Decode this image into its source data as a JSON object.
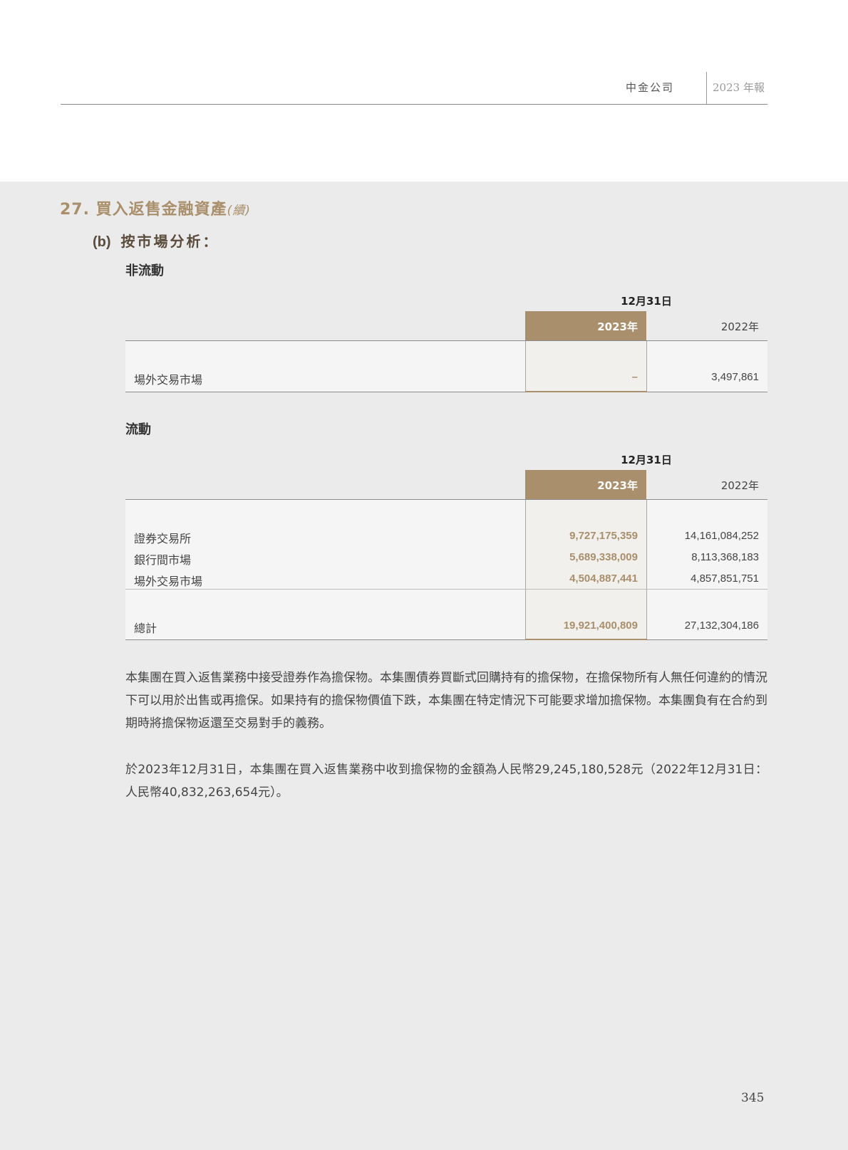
{
  "header": {
    "company": "中金公司",
    "report": "2023 年報"
  },
  "section": {
    "title": "27. 買入返售金融資產",
    "continued": "(續)"
  },
  "subsection": {
    "label": "(b)",
    "title": "按市場分析："
  },
  "tables": {
    "non_current": {
      "title": "非流動",
      "date_header": "12月31日",
      "col_2023": "2023年",
      "col_2022": "2022年",
      "rows": [
        {
          "label": "場外交易市場",
          "v2023": "–",
          "v2022": "3,497,861"
        }
      ]
    },
    "current": {
      "title": "流動",
      "date_header": "12月31日",
      "col_2023": "2023年",
      "col_2022": "2022年",
      "rows": [
        {
          "label": "證券交易所",
          "v2023": "9,727,175,359",
          "v2022": "14,161,084,252"
        },
        {
          "label": "銀行間市場",
          "v2023": "5,689,338,009",
          "v2022": "8,113,368,183"
        },
        {
          "label": "場外交易市場",
          "v2023": "4,504,887,441",
          "v2022": "4,857,851,751"
        }
      ],
      "total": {
        "label": "總計",
        "v2023": "19,921,400,809",
        "v2022": "27,132,304,186"
      }
    }
  },
  "paragraphs": [
    "本集團在買入返售業務中接受證券作為擔保物。本集團債券買斷式回購持有的擔保物，在擔保物所有人無任何違約的情況下可以用於出售或再擔保。如果持有的擔保物價值下跌，本集團在特定情況下可能要求增加擔保物。本集團負有在合約到期時將擔保物返還至交易對手的義務。",
    "於2023年12月31日，本集團在買入返售業務中收到擔保物的金額為人民幣29,245,180,528元（2022年12月31日：人民幣40,832,263,654元）。"
  ],
  "page_number": "345",
  "colors": {
    "accent": "#a98f6c",
    "background": "#ebebeb"
  }
}
